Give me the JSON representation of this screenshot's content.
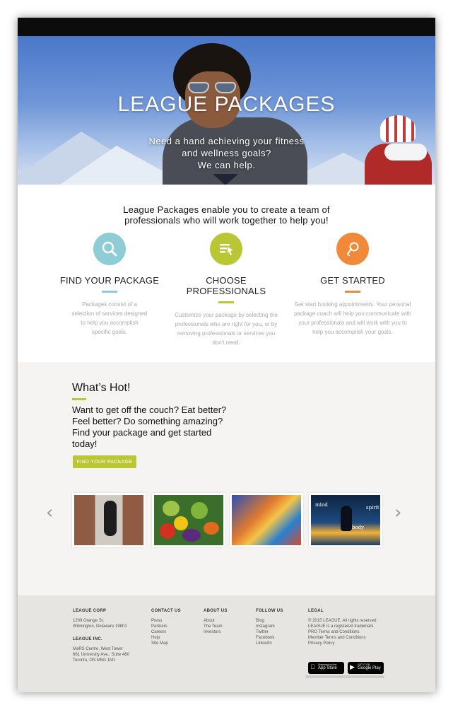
{
  "hero": {
    "title": "LEAGUE PACKAGES",
    "subtitle_line1": "Need a hand achieving your fitness",
    "subtitle_line2": "and wellness goals?",
    "subtitle_line3": "We can help."
  },
  "intro": {
    "text": "League Packages enable you to create a team of professionals who will work together to help you!"
  },
  "features": [
    {
      "title": "FIND YOUR PACKAGE",
      "icon": "magnifier-icon",
      "color": "#8ecdd5",
      "description": "Packages consist of a selection of services designed to help you accomplish specific goals."
    },
    {
      "title": "CHOOSE PROFESSIONALS",
      "icon": "list-cursor-icon",
      "color": "#b8c733",
      "description": "Customize your package by selecting the professionals who are right for you, or by removing professionals or services you don't need."
    },
    {
      "title": "GET STARTED",
      "icon": "whistle-icon",
      "color": "#f08a3a",
      "description": "Get start booking appointments. Your personal package coach will help you communicate with your professionals and will work with you to help you accomplish your goals."
    }
  ],
  "hot": {
    "title": "What’s Hot!",
    "text": "Want to get off the couch? Eat better? Feel better? Do something amazing? Find your package and get started today!",
    "button_label": "FIND YOUR PACKAGE",
    "accent": "#b8c733",
    "prev_arrow": "‹",
    "next_arrow": "›",
    "thumb4_words": [
      "mind",
      "spirit",
      "body"
    ]
  },
  "footer": {
    "corp": {
      "heading": "LEAGUE CORP",
      "lines": [
        "1209 Orange St.",
        "Wilmington, Delaware 19801"
      ]
    },
    "inc": {
      "heading": "LEAGUE INC.",
      "lines": [
        "MaRS Centre, West Tower",
        "661 University Ave., Suite 480",
        "Toronto, ON M5G 1M1"
      ]
    },
    "contact": {
      "heading": "CONTACT US",
      "links": [
        "Press",
        "Partners",
        "Careers",
        "Help",
        "Site Map"
      ]
    },
    "about": {
      "heading": "ABOUT US",
      "links": [
        "About",
        "The Team",
        "Investors"
      ]
    },
    "follow": {
      "heading": "FOLLOW US",
      "links": [
        "Blog",
        "Instagram",
        "Twitter",
        "Facebook",
        "LinkedIn"
      ]
    },
    "legal": {
      "heading": "LEGAL",
      "lines": [
        "© 2015 LEAGUE. All rights reserved.",
        "LEAGUE is a registered trademark."
      ],
      "links": [
        "PRO Terms and Conditions",
        "Member Terms and Conditions",
        "Privacy Policy"
      ]
    },
    "appstore": {
      "small": "Download on the",
      "label": "App Store"
    },
    "googleplay": {
      "small": "GET IT ON",
      "label": "Google Play"
    }
  }
}
